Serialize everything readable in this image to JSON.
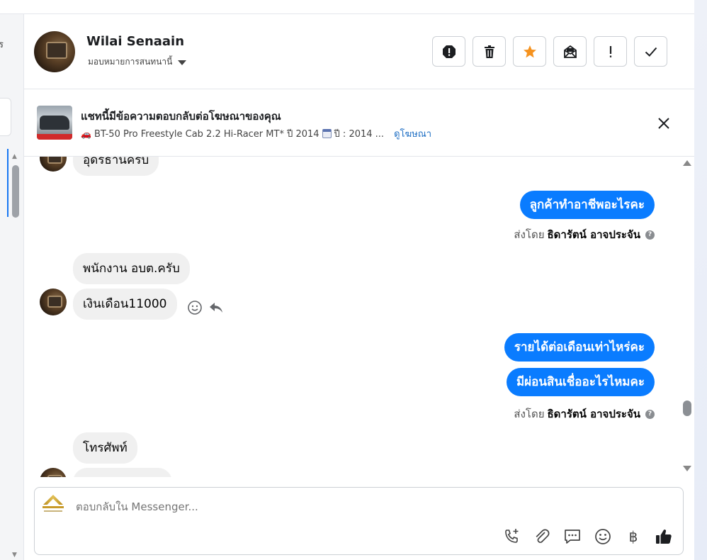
{
  "sidebar": {
    "partial_text": "ร"
  },
  "header": {
    "name": "Wilai Senaain",
    "assign_label": "มอบหมายการสนทนานี้",
    "actions": [
      {
        "name": "alert-icon"
      },
      {
        "name": "trash-icon"
      },
      {
        "name": "star-icon",
        "color": "#f5921e"
      },
      {
        "name": "mark-unread-icon"
      },
      {
        "name": "exclamation-icon"
      },
      {
        "name": "check-icon"
      }
    ]
  },
  "ad_banner": {
    "title": "แชทนี้มีข้อความตอบกลับต่อโฆษณาของคุณ",
    "subtitle": "BT-50 Pro Freestyle Cab 2.2 Hi-Racer MT* ปี 2014",
    "subtitle_year": "ปี : 2014 ...",
    "link": "ดูโฆษณา"
  },
  "messages": [
    {
      "id": "m1",
      "direction": "in",
      "text": "อุดรธานีครับ"
    },
    {
      "id": "m2",
      "direction": "out",
      "text": "ลูกค้าทำอาชีพอะไรคะ"
    },
    {
      "id": "m3",
      "direction": "in",
      "text": "พนักงาน อบต.ครับ"
    },
    {
      "id": "m4",
      "direction": "in",
      "text": "เงินเดือน11000"
    },
    {
      "id": "m5",
      "direction": "out",
      "text": "รายได้ต่อเดือนเท่าไหร่คะ"
    },
    {
      "id": "m6",
      "direction": "out",
      "text": "มีผ่อนสินเชื่ออะไรไหมคะ"
    },
    {
      "id": "m7",
      "direction": "in",
      "text": "โทรศัพท์"
    }
  ],
  "sent_by": {
    "prefix": "ส่งโดย",
    "name": "ธิดารัตน์ อาจประจัน",
    "help": "?"
  },
  "composer": {
    "placeholder": "ตอบกลับใน Messenger...",
    "tools": [
      "call-add-icon",
      "attachment-icon",
      "chat-icon",
      "emoji-icon",
      "baht-icon",
      "like-icon"
    ],
    "baht_symbol": "฿"
  },
  "colors": {
    "accent": "#0a7cff",
    "link": "#1f6fc4",
    "star": "#f5921e"
  }
}
